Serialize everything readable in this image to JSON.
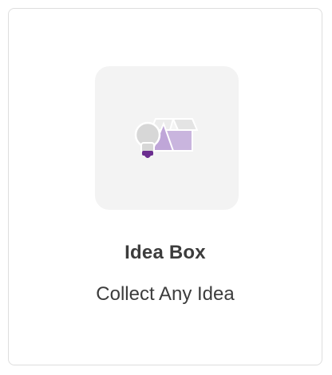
{
  "app": {
    "title": "Idea Box",
    "description": "Collect Any Idea",
    "icon": "idea-box-icon"
  },
  "colors": {
    "box_fill": "#c9b5de",
    "box_lid": "#e4e4e4",
    "bulb_glass": "#d7d7d7",
    "bulb_base": "#6b2d8f",
    "tile_bg": "#f3f3f3",
    "text": "#3c3c3c"
  }
}
